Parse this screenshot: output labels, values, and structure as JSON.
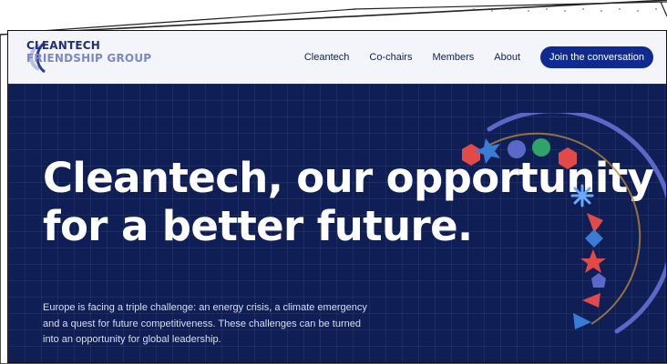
{
  "logo": {
    "line1": "CLEANTECH",
    "line2": "FRIENDSHIP GROUP"
  },
  "nav": {
    "items": [
      "Cleantech",
      "Co-chairs",
      "Members",
      "About"
    ],
    "cta": "Join the conversation"
  },
  "hero": {
    "headline_line1": "Cleantech, our opportunity",
    "headline_line2": "for a better future.",
    "subtext_line1": "Europe is facing a triple challenge: an energy crisis, a climate emergency",
    "subtext_line2": "and a quest for future competitiveness. These challenges can be turned",
    "subtext_line3": "into an opportunity for global leadership."
  },
  "colors": {
    "bg": "#0f1f55",
    "topbar": "#f3f5fb",
    "brand_dark": "#1f2f79",
    "brand_light": "#7b88c7",
    "cta": "#0f2b8f",
    "accent_red": "#e24a4a",
    "accent_blue": "#3a7bd5",
    "accent_green": "#2ea36a"
  }
}
